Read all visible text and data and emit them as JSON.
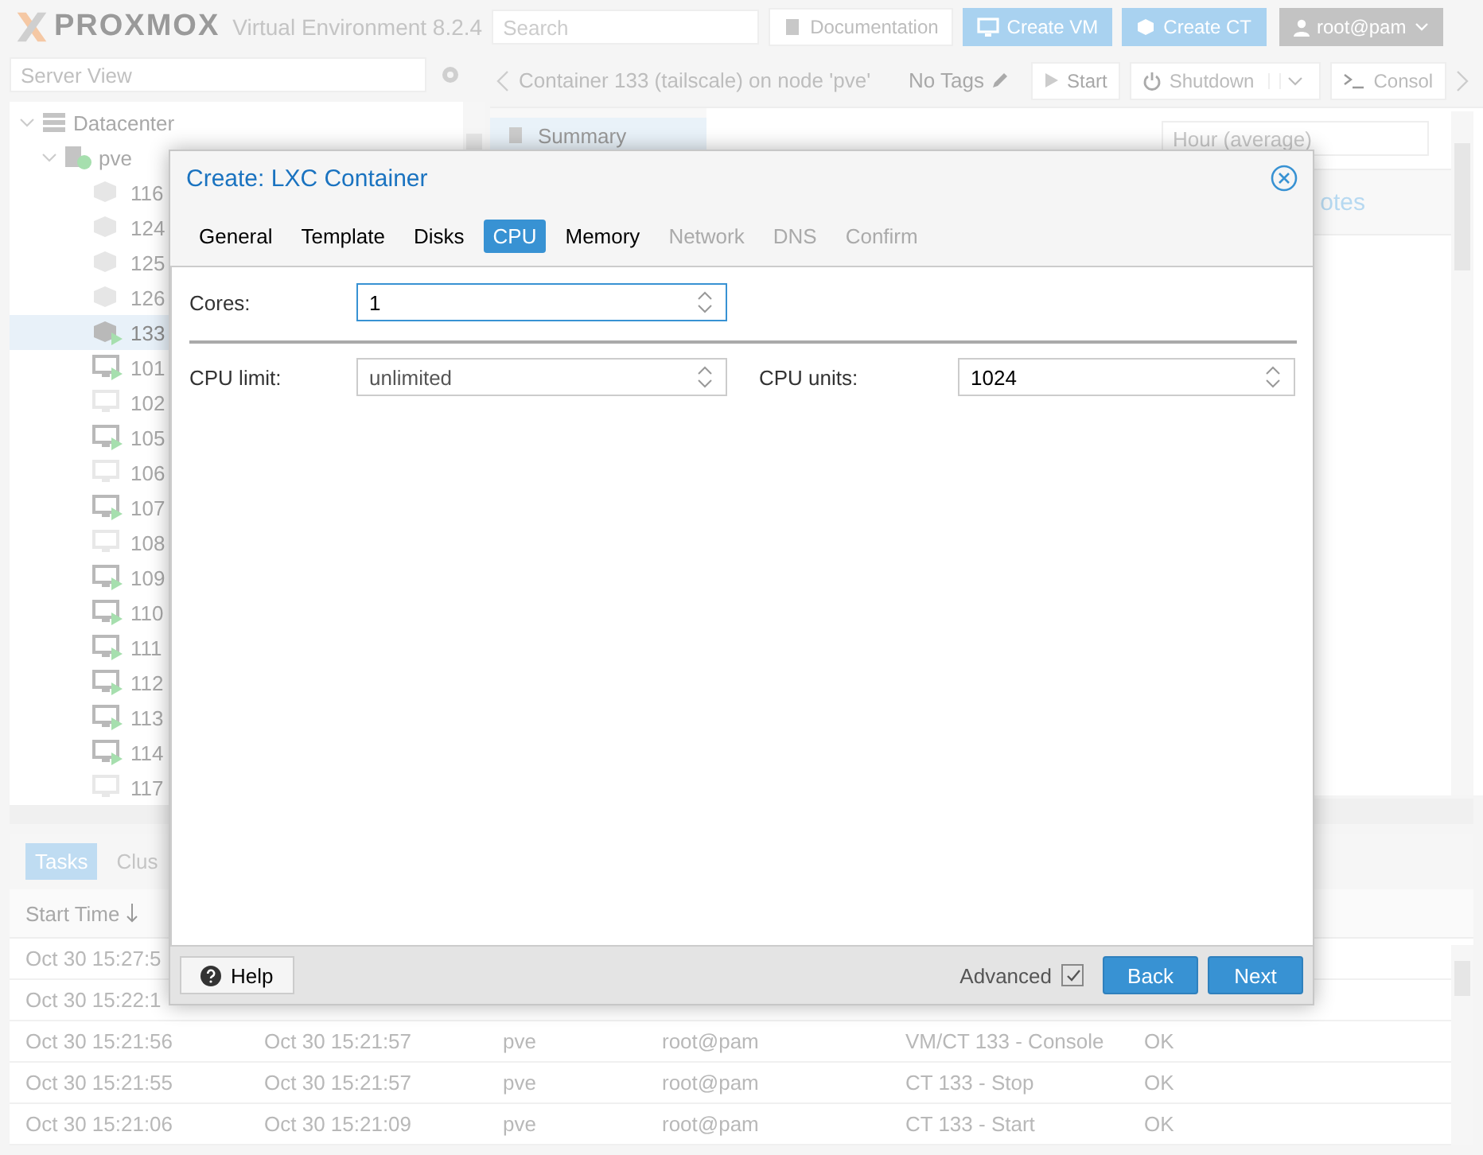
{
  "header": {
    "logo": "PROXMOX",
    "product": "Virtual Environment 8.2.4",
    "search": {
      "placeholder": "Search"
    },
    "buttons": [
      {
        "label": "Documentation",
        "kind": "plain"
      },
      {
        "label": "Create VM",
        "kind": "primary"
      },
      {
        "label": "Create CT",
        "kind": "primary"
      }
    ],
    "user": "root@pam"
  },
  "sidebar": {
    "view": "Server View",
    "tree": [
      {
        "label": "Datacenter",
        "kind": "datacenter",
        "expanded": true,
        "selected": false,
        "children": [
          {
            "label": "pve",
            "kind": "node",
            "expanded": true,
            "selected": false,
            "children": [
              {
                "label": "116",
                "kind": "ct",
                "running": false,
                "selected": false
              },
              {
                "label": "124",
                "kind": "ct",
                "running": false,
                "selected": false
              },
              {
                "label": "125",
                "kind": "ct",
                "running": false,
                "selected": false
              },
              {
                "label": "126",
                "kind": "ct",
                "running": false,
                "selected": false
              },
              {
                "label": "133",
                "kind": "ct",
                "running": true,
                "selected": true
              },
              {
                "label": "101",
                "kind": "vm",
                "running": true,
                "selected": false
              },
              {
                "label": "102",
                "kind": "vm",
                "running": false,
                "selected": false
              },
              {
                "label": "105",
                "kind": "vm",
                "running": true,
                "selected": false
              },
              {
                "label": "106",
                "kind": "vm",
                "running": false,
                "selected": false
              },
              {
                "label": "107",
                "kind": "vm",
                "running": true,
                "selected": false
              },
              {
                "label": "108",
                "kind": "vm",
                "running": false,
                "selected": false
              },
              {
                "label": "109",
                "kind": "vm",
                "running": true,
                "selected": false
              },
              {
                "label": "110",
                "kind": "vm",
                "running": true,
                "selected": false
              },
              {
                "label": "111",
                "kind": "vm",
                "running": true,
                "selected": false
              },
              {
                "label": "112",
                "kind": "vm",
                "running": true,
                "selected": false
              },
              {
                "label": "113",
                "kind": "vm",
                "running": true,
                "selected": false
              },
              {
                "label": "114",
                "kind": "vm",
                "running": true,
                "selected": false
              },
              {
                "label": "117",
                "kind": "vm",
                "running": false,
                "selected": false
              }
            ]
          }
        ]
      }
    ]
  },
  "content": {
    "title": "Container 133 (tailscale) on node 'pve'",
    "tags": "No Tags",
    "actions": [
      {
        "label": "Start",
        "kind": "start"
      },
      {
        "label": "Shutdown",
        "kind": "shutdown"
      },
      {
        "label": "Consol",
        "kind": "console"
      }
    ],
    "nav": [
      {
        "label": "Summary",
        "selected": true
      }
    ],
    "timeframe": "Hour (average)",
    "tab_fragment": "otes"
  },
  "tasks": {
    "tabs": [
      {
        "label": "Tasks",
        "selected": true
      },
      {
        "label": "Clus",
        "selected": false
      }
    ],
    "sort_column": "Start Time",
    "rows": [
      {
        "start": "Oct 30 15:27:5"
      },
      {
        "start": "Oct 30 15:22:1"
      },
      {
        "start": "Oct 30 15:21:56",
        "end": "Oct 30 15:21:57",
        "node": "pve",
        "user": "root@pam",
        "description": "VM/CT 133 - Console",
        "status": "OK"
      },
      {
        "start": "Oct 30 15:21:55",
        "end": "Oct 30 15:21:57",
        "node": "pve",
        "user": "root@pam",
        "description": "CT 133 - Stop",
        "status": "OK"
      },
      {
        "start": "Oct 30 15:21:06",
        "end": "Oct 30 15:21:09",
        "node": "pve",
        "user": "root@pam",
        "description": "CT 133 - Start",
        "status": "OK"
      }
    ]
  },
  "dialog": {
    "title": "Create: LXC Container",
    "tabs": [
      {
        "label": "General",
        "selected": false,
        "disabled": false
      },
      {
        "label": "Template",
        "selected": false,
        "disabled": false
      },
      {
        "label": "Disks",
        "selected": false,
        "disabled": false
      },
      {
        "label": "CPU",
        "selected": true,
        "disabled": false
      },
      {
        "label": "Memory",
        "selected": false,
        "disabled": false
      },
      {
        "label": "Network",
        "selected": false,
        "disabled": true
      },
      {
        "label": "DNS",
        "selected": false,
        "disabled": true
      },
      {
        "label": "Confirm",
        "selected": false,
        "disabled": true
      }
    ],
    "cores": {
      "label": "Cores:",
      "value": "1",
      "focused": true
    },
    "cpu_limit": {
      "label": "CPU limit:",
      "value": "unlimited"
    },
    "cpu_units": {
      "label": "CPU units:",
      "value": "1024"
    },
    "help": "Help",
    "advanced": {
      "label": "Advanced",
      "checked": true
    },
    "buttons": [
      "Back",
      "Next"
    ]
  }
}
